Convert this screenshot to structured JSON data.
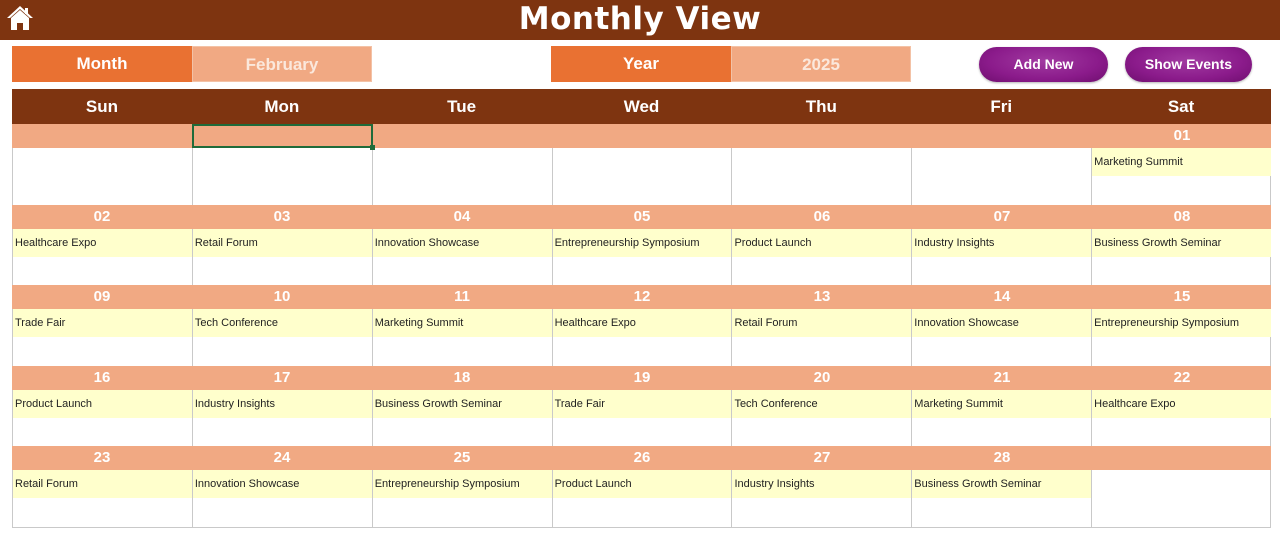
{
  "header": {
    "title": "Monthly View",
    "home_icon": "home-icon"
  },
  "controls": {
    "month_label": "Month",
    "month_value": "February",
    "year_label": "Year",
    "year_value": "2025",
    "add_new_label": "Add New",
    "show_events_label": "Show Events"
  },
  "colors": {
    "header": "#7e3410",
    "label": "#e97132",
    "value": "#f1a983",
    "event": "#ffffcc",
    "button": "#8b1b8b"
  },
  "days_of_week": [
    "Sun",
    "Mon",
    "Tue",
    "Wed",
    "Thu",
    "Fri",
    "Sat"
  ],
  "weeks": [
    [
      {
        "date": "",
        "event": ""
      },
      {
        "date": "",
        "event": ""
      },
      {
        "date": "",
        "event": ""
      },
      {
        "date": "",
        "event": ""
      },
      {
        "date": "",
        "event": ""
      },
      {
        "date": "",
        "event": ""
      },
      {
        "date": "01",
        "event": "Marketing Summit"
      }
    ],
    [
      {
        "date": "02",
        "event": "Healthcare Expo"
      },
      {
        "date": "03",
        "event": "Retail Forum"
      },
      {
        "date": "04",
        "event": "Innovation Showcase"
      },
      {
        "date": "05",
        "event": "Entrepreneurship Symposium"
      },
      {
        "date": "06",
        "event": "Product Launch"
      },
      {
        "date": "07",
        "event": "Industry Insights"
      },
      {
        "date": "08",
        "event": "Business Growth Seminar"
      }
    ],
    [
      {
        "date": "09",
        "event": "Trade Fair"
      },
      {
        "date": "10",
        "event": "Tech Conference"
      },
      {
        "date": "11",
        "event": "Marketing Summit"
      },
      {
        "date": "12",
        "event": "Healthcare Expo"
      },
      {
        "date": "13",
        "event": "Retail Forum"
      },
      {
        "date": "14",
        "event": "Innovation Showcase"
      },
      {
        "date": "15",
        "event": "Entrepreneurship Symposium"
      }
    ],
    [
      {
        "date": "16",
        "event": "Product Launch"
      },
      {
        "date": "17",
        "event": "Industry Insights"
      },
      {
        "date": "18",
        "event": "Business Growth Seminar"
      },
      {
        "date": "19",
        "event": "Trade Fair"
      },
      {
        "date": "20",
        "event": "Tech Conference"
      },
      {
        "date": "21",
        "event": "Marketing Summit"
      },
      {
        "date": "22",
        "event": "Healthcare Expo"
      }
    ],
    [
      {
        "date": "23",
        "event": "Retail Forum"
      },
      {
        "date": "24",
        "event": "Innovation Showcase"
      },
      {
        "date": "25",
        "event": "Entrepreneurship Symposium"
      },
      {
        "date": "26",
        "event": "Product Launch"
      },
      {
        "date": "27",
        "event": "Industry Insights"
      },
      {
        "date": "28",
        "event": "Business Growth Seminar"
      },
      {
        "date": "",
        "event": ""
      }
    ]
  ]
}
